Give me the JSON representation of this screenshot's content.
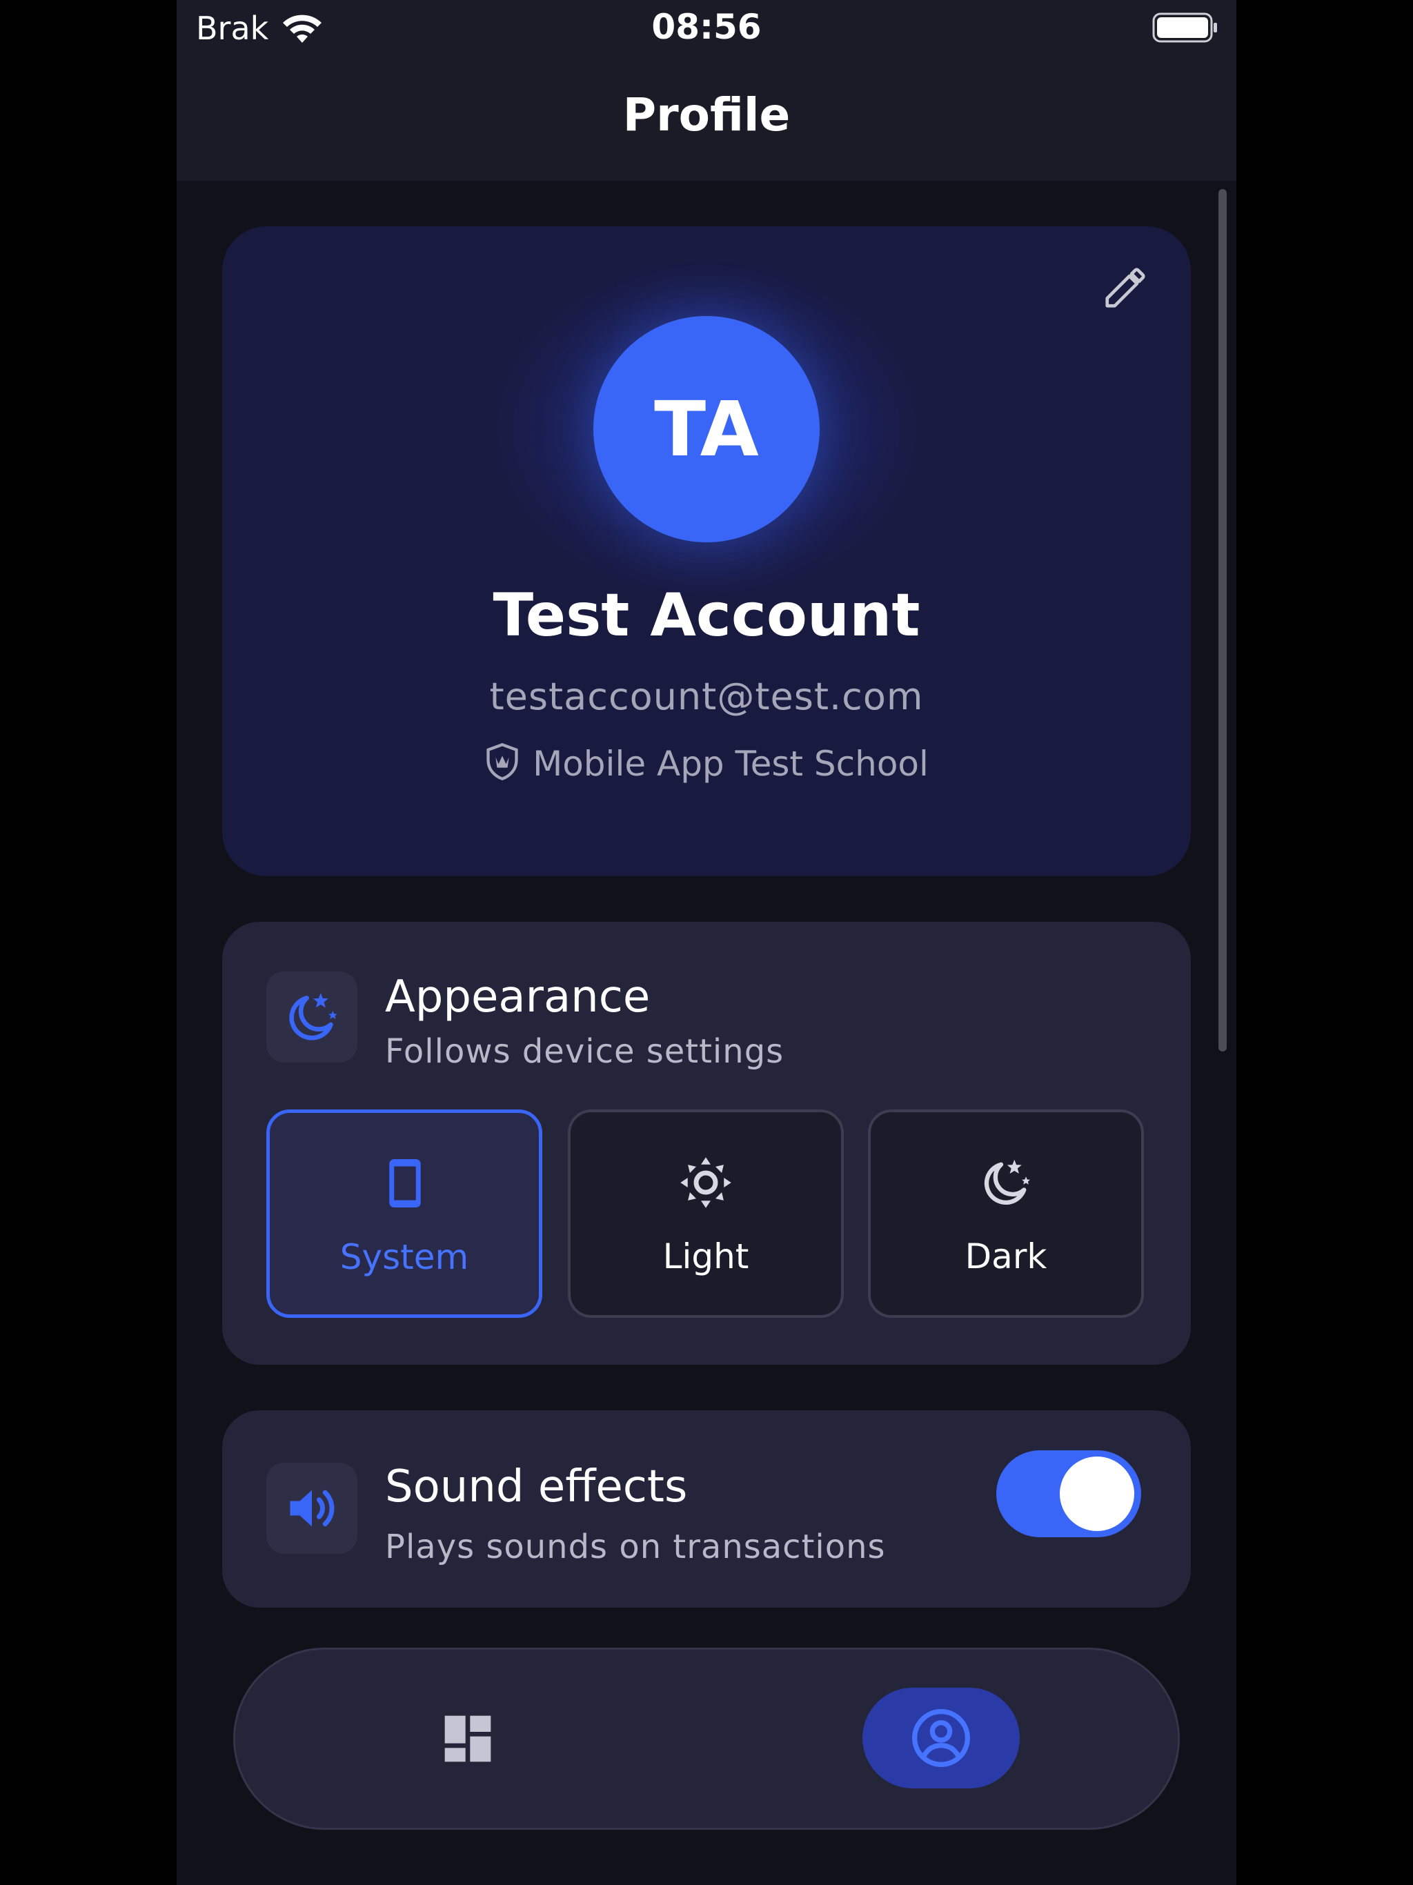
{
  "status_bar": {
    "carrier": "Brak",
    "time": "08:56",
    "icons": [
      "wifi-icon",
      "battery-icon"
    ]
  },
  "header": {
    "title": "Profile"
  },
  "profile": {
    "initials": "TA",
    "name": "Test Account",
    "email": "testaccount@test.com",
    "school": "Mobile App Test School",
    "edit_icon": "pencil-icon",
    "school_icon": "shield-icon"
  },
  "appearance": {
    "title": "Appearance",
    "subtitle": "Follows device settings",
    "icon": "moon-stars-icon",
    "options": [
      {
        "label": "System",
        "icon": "phone-icon",
        "selected": true
      },
      {
        "label": "Light",
        "icon": "sun-icon",
        "selected": false
      },
      {
        "label": "Dark",
        "icon": "moon-stars-icon",
        "selected": false
      }
    ]
  },
  "sound": {
    "title": "Sound effects",
    "subtitle": "Plays sounds on transactions",
    "icon": "speaker-icon",
    "enabled": true
  },
  "bottom_nav": {
    "items": [
      {
        "icon": "dashboard-icon",
        "active": false
      },
      {
        "icon": "profile-icon",
        "active": true
      }
    ]
  },
  "colors": {
    "accent": "#3a66f7",
    "background": "#111119",
    "card": "#24243a",
    "profile_card": "#191a3f"
  }
}
